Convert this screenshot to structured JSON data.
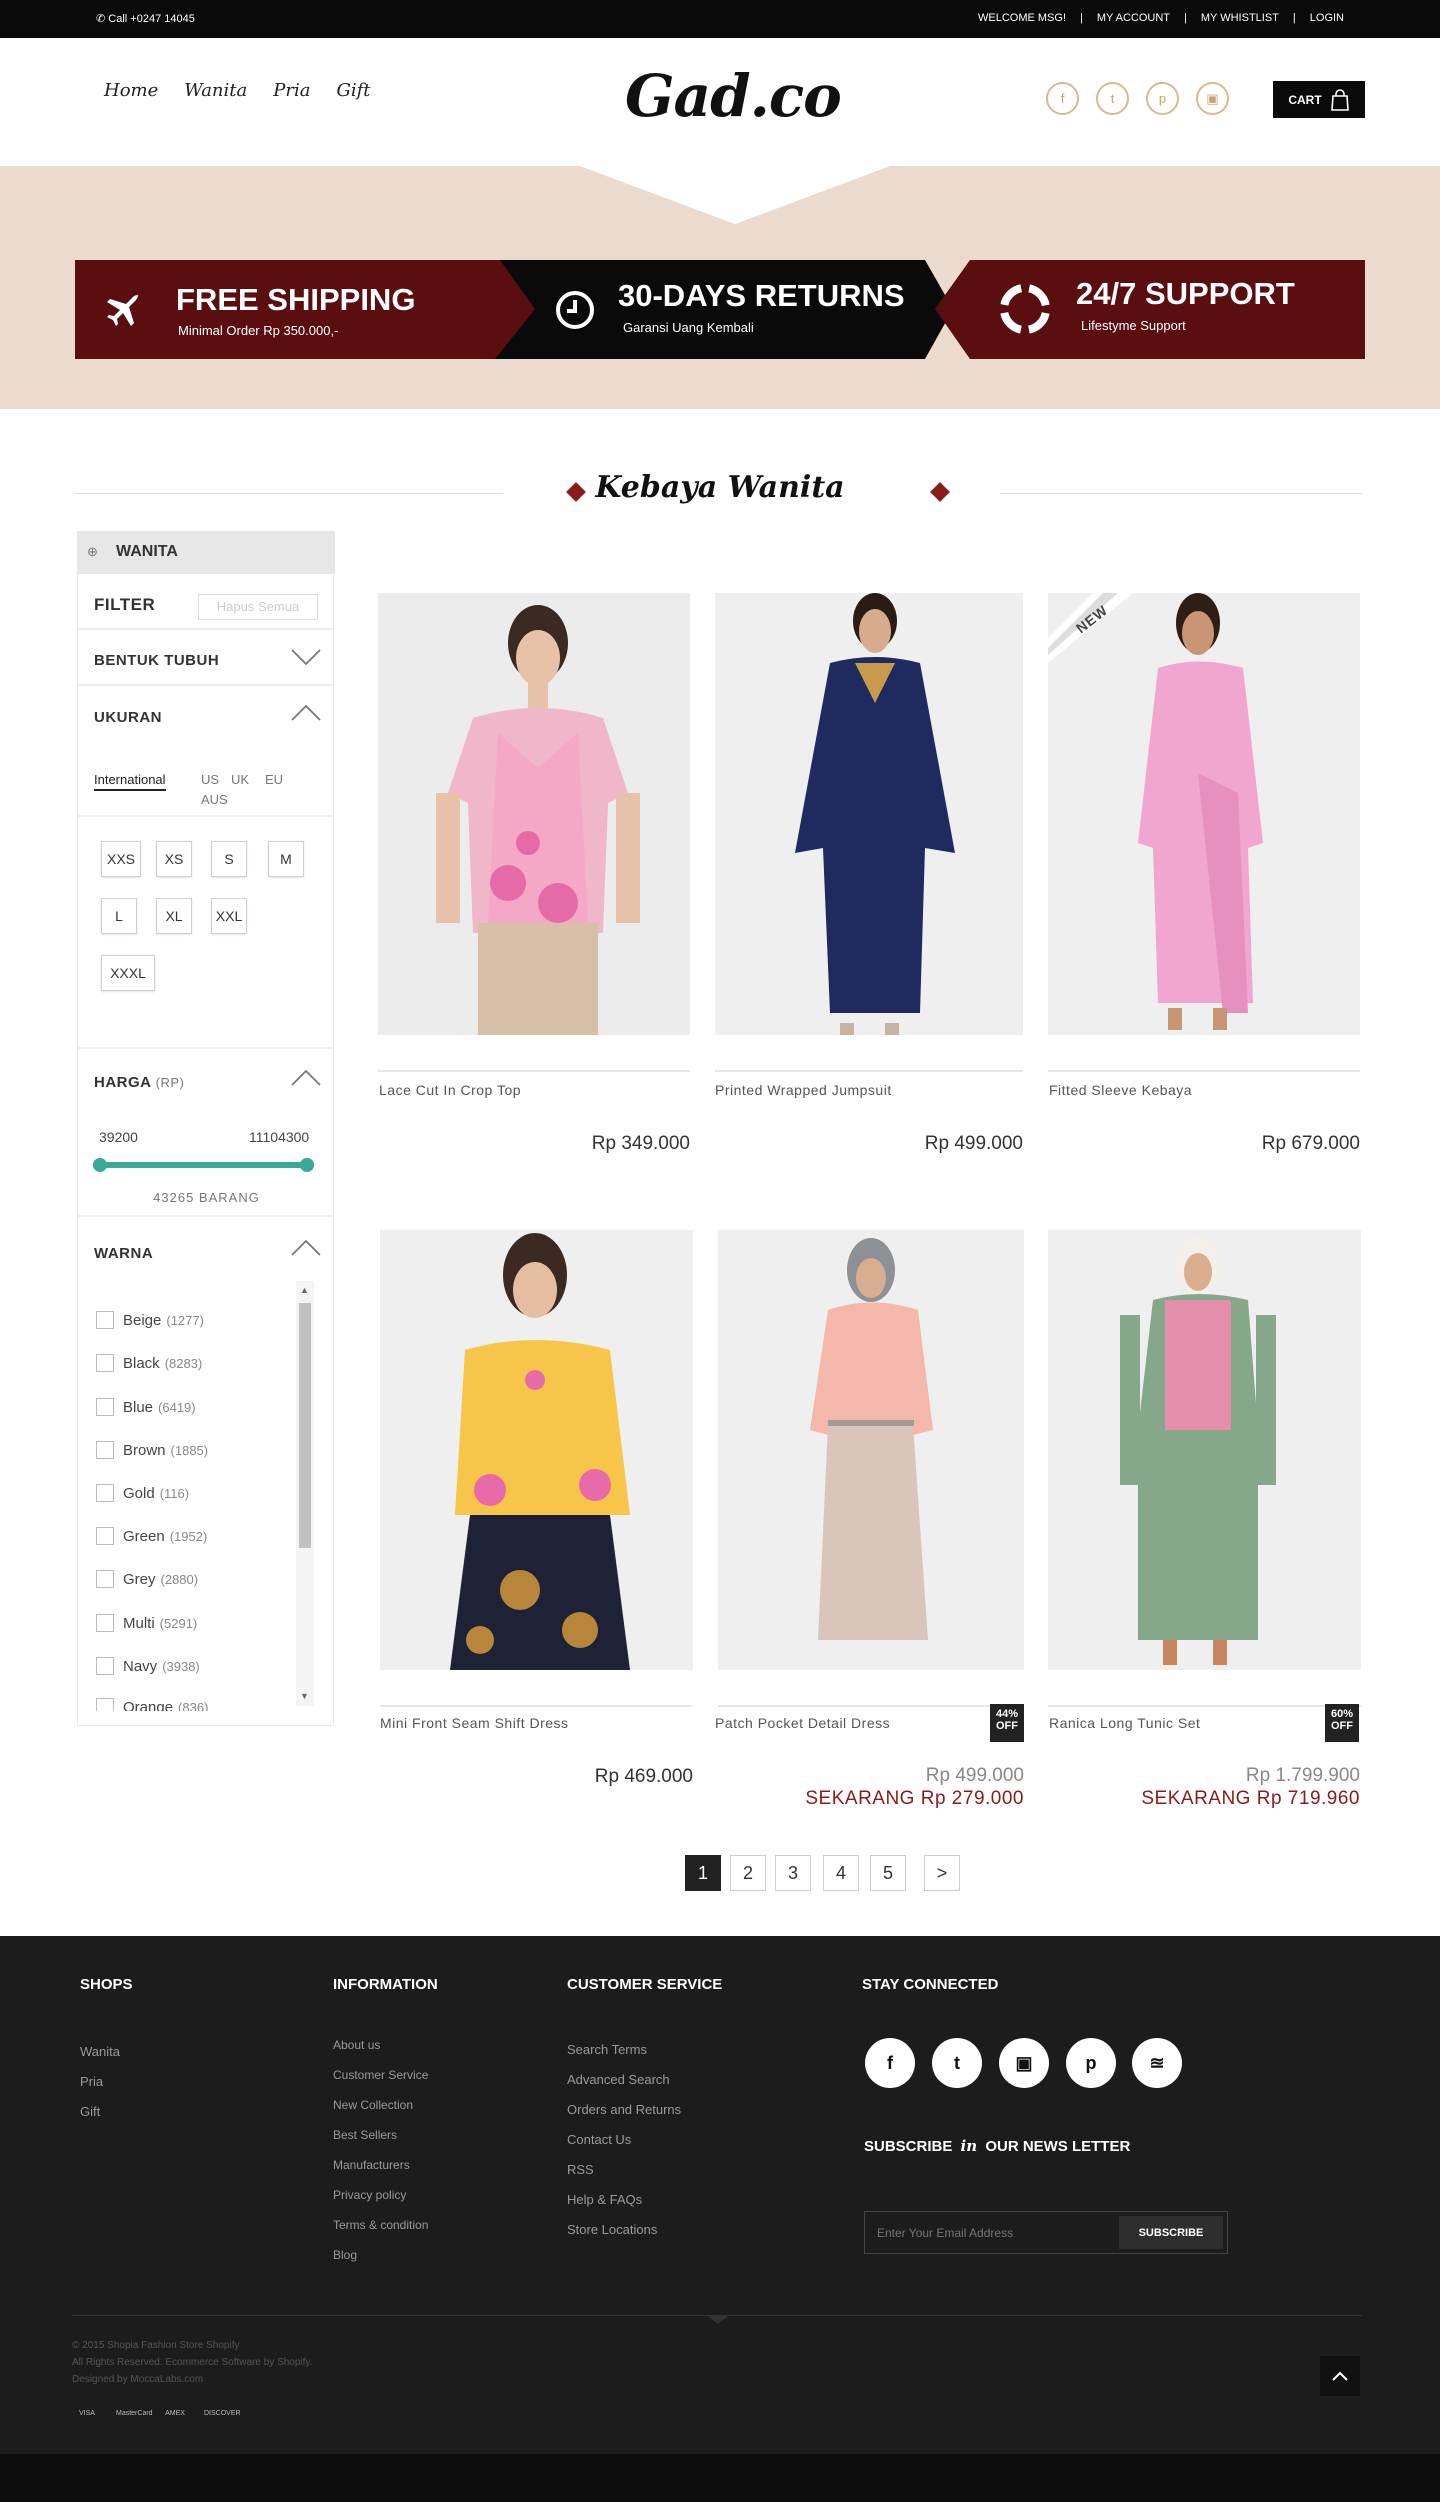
{
  "topbar": {
    "call": "Call +0247 14045",
    "links": [
      "WELCOME MSG!",
      "MY ACCOUNT",
      "MY WHISTLIST",
      "LOGIN"
    ]
  },
  "nav": {
    "items": [
      "Home",
      "Wanita",
      "Pria",
      "Gift"
    ]
  },
  "logo": "Gad.co",
  "social_header": [
    "facebook-icon",
    "twitter-icon",
    "pinterest-icon",
    "instagram-icon"
  ],
  "cart": {
    "label": "CART"
  },
  "features": [
    {
      "title": "FREE SHIPPING",
      "subtitle": "Minimal  Order Rp 350.000,-",
      "icon": "airplane-icon",
      "bg": "#5a0e10"
    },
    {
      "title": "30-DAYS RETURNS",
      "subtitle": "Garansi Uang Kembali",
      "icon": "clock-icon",
      "bg": "#0a0a0a"
    },
    {
      "title": "24/7 SUPPORT",
      "subtitle": "Lifestyme Support",
      "icon": "lifebuoy-icon",
      "bg": "#5a0e10"
    }
  ],
  "section_title": "Kebaya Wanita",
  "sidebar": {
    "category": "WANITA",
    "filter_label": "FILTER",
    "clear_all": "Hapus Semua",
    "body_shape": "BENTUK TUBUH",
    "size_title": "UKURAN",
    "size_tabs": [
      "International",
      "US",
      "UK",
      "EU",
      "AUS"
    ],
    "sizes": [
      "XXS",
      "XS",
      "S",
      "M",
      "L",
      "XL",
      "XXL",
      "XXXL"
    ],
    "price_title": "HARGA",
    "price_unit": "(RP)",
    "price_min": "39200",
    "price_max": "11104300",
    "count": "43265 BARANG",
    "color_title": "WARNA",
    "colors": [
      {
        "name": "Beige",
        "count": "(1277)"
      },
      {
        "name": "Black",
        "count": "(8283)"
      },
      {
        "name": "Blue",
        "count": "(6419)"
      },
      {
        "name": "Brown",
        "count": "(1885)"
      },
      {
        "name": "Gold",
        "count": "(116)"
      },
      {
        "name": "Green",
        "count": "(1952)"
      },
      {
        "name": "Grey",
        "count": "(2880)"
      },
      {
        "name": "Multi",
        "count": "(5291)"
      },
      {
        "name": "Navy",
        "count": "(3938)"
      },
      {
        "name": "Orange",
        "count": "(836)"
      }
    ]
  },
  "products": [
    {
      "name": "Lace Cut In Crop Top",
      "price": "Rp 349.000"
    },
    {
      "name": "Printed Wrapped Jumpsuit",
      "price": "Rp 499.000"
    },
    {
      "name": "Fitted Sleeve Kebaya",
      "price": "Rp 679.000",
      "badge": "NEW"
    },
    {
      "name": "Mini Front Seam Shift Dress",
      "price": "Rp 469.000"
    },
    {
      "name": "Patch Pocket Detail Dress",
      "price": "Rp 499.000",
      "sale_price": "SEKARANG Rp 279.000",
      "discount": "44%",
      "off": "OFF"
    },
    {
      "name": "Ranica Long Tunic Set",
      "price": "Rp 1.799.900",
      "sale_price": "SEKARANG Rp 719.960",
      "discount": "60%",
      "off": "OFF"
    }
  ],
  "pagination": [
    "1",
    "2",
    "3",
    "4",
    "5",
    ">"
  ],
  "footer": {
    "shops_title": "SHOPS",
    "shops": [
      "Wanita",
      "Pria",
      "Gift"
    ],
    "info_title": "INFORMATION",
    "info": [
      "About us",
      "Customer Service",
      "New Collection",
      "Best Sellers",
      "Manufacturers",
      "Privacy policy",
      "Terms & condition",
      "Blog"
    ],
    "cs_title": "CUSTOMER SERVICE",
    "cs": [
      "Search Terms",
      "Advanced Search",
      "Orders and Returns",
      "Contact Us",
      "RSS",
      "Help & FAQs",
      "Store Locations"
    ],
    "stay_title": "STAY CONNECTED",
    "social": [
      "facebook-icon",
      "twitter-icon",
      "instagram-icon",
      "pinterest-icon",
      "rss-icon"
    ],
    "subscribe_a": "SUBSCRIBE",
    "subscribe_in": "in",
    "subscribe_b": "OUR NEWS LETTER",
    "email_placeholder": "Enter Your Email Address",
    "subscribe_button": "SUBSCRIBE",
    "copyright": [
      "© 2015  Shopia  Fashion Store Shopify",
      "All Rights Reserved. Ecommerce Software by Shopify.",
      "Designed by  MoccaLabs.com"
    ],
    "payments": [
      "VISA",
      "MasterCard",
      "AMEX",
      "DISCOVER"
    ]
  }
}
